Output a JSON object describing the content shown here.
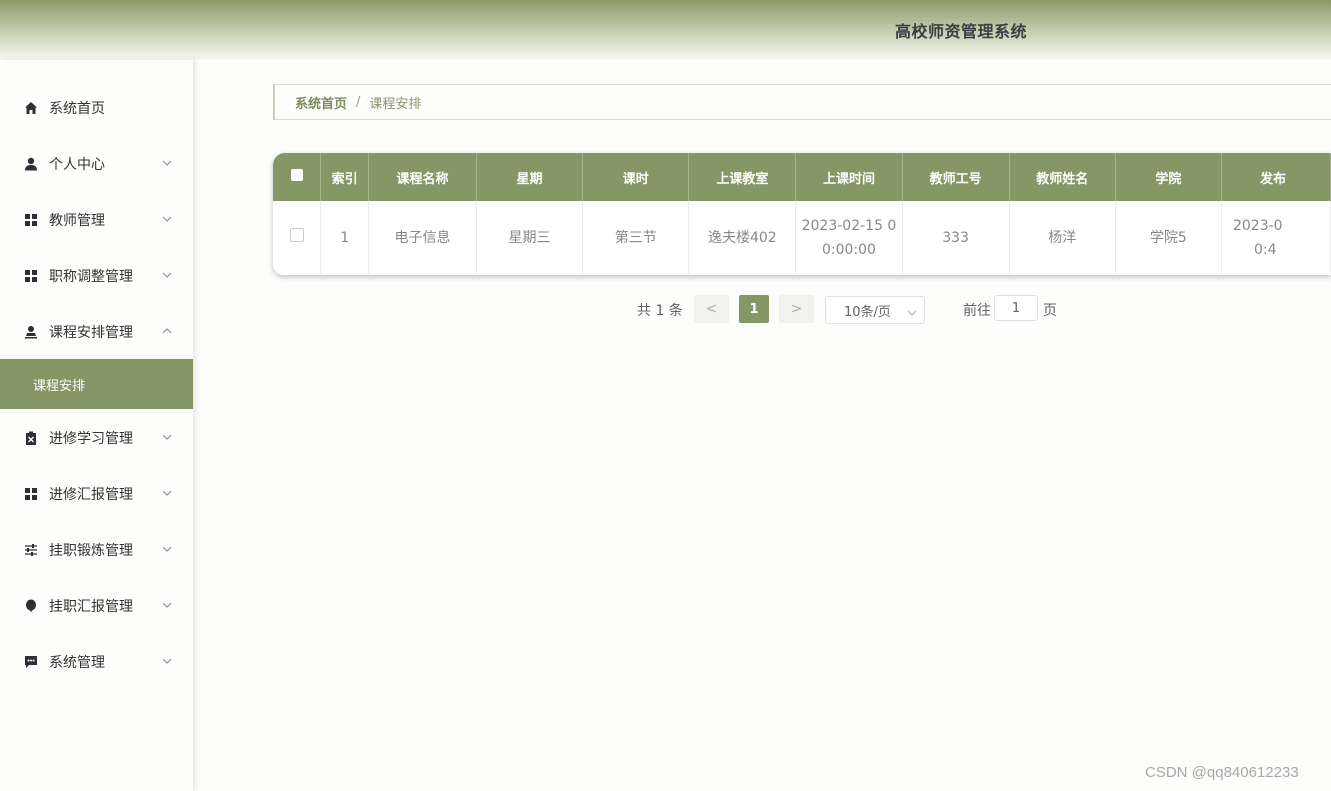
{
  "header": {
    "title": "高校师资管理系统"
  },
  "sidebar": {
    "items": [
      {
        "label": "系统首页",
        "icon": "home-icon",
        "chevron": ""
      },
      {
        "label": "个人中心",
        "icon": "user-icon",
        "chevron": "down"
      },
      {
        "label": "教师管理",
        "icon": "grid-icon",
        "chevron": "down"
      },
      {
        "label": "职称调整管理",
        "icon": "grid-icon",
        "chevron": "down"
      },
      {
        "label": "课程安排管理",
        "icon": "person-stamp-icon",
        "chevron": "up"
      },
      {
        "label": "进修学习管理",
        "icon": "clipboard-x-icon",
        "chevron": "down"
      },
      {
        "label": "进修汇报管理",
        "icon": "grid-icon",
        "chevron": "down"
      },
      {
        "label": "挂职锻炼管理",
        "icon": "sliders-icon",
        "chevron": "down"
      },
      {
        "label": "挂职汇报管理",
        "icon": "balloon-icon",
        "chevron": "down"
      },
      {
        "label": "系统管理",
        "icon": "chat-icon",
        "chevron": "down"
      }
    ],
    "active_subitem": "课程安排"
  },
  "breadcrumb": {
    "home": "系统首页",
    "separator": "/",
    "current": "课程安排"
  },
  "table": {
    "columns": [
      "索引",
      "课程名称",
      "星期",
      "课时",
      "上课教室",
      "上课时间",
      "教师工号",
      "教师姓名",
      "学院",
      "发布"
    ],
    "rows": [
      [
        "1",
        "电子信息",
        "星期三",
        "第三节",
        "逸夫楼402",
        "2023-02-15 00:00:00",
        "333",
        "杨洋",
        "学院5",
        "2023-0"
      ]
    ],
    "last_cell_lines": [
      "2023-0",
      "0:4"
    ]
  },
  "pagination": {
    "total": "共 1 条",
    "prev": "<",
    "current": "1",
    "next": ">",
    "page_size": "10条/页",
    "goto_label": "前往",
    "goto_value": "1",
    "page_suffix": "页"
  },
  "watermark": "CSDN @qq840612233",
  "colors": {
    "accent": "#859767",
    "header_text": "#3b3f45"
  }
}
